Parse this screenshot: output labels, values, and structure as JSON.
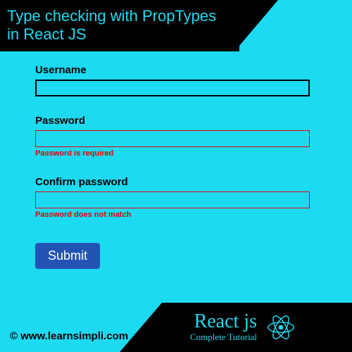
{
  "header": {
    "title": "Type checking with PropTypes\n in React JS"
  },
  "form": {
    "username": {
      "label": "Username",
      "value": "",
      "hasError": false
    },
    "password": {
      "label": "Password",
      "value": "",
      "hasError": true,
      "errorMsg": "Password is required"
    },
    "confirmPassword": {
      "label": "Confirm password",
      "value": "",
      "hasError": true,
      "errorMsg": "Password does not match"
    },
    "submitLabel": "Submit"
  },
  "footer": {
    "copyright": "©   www.learnsimpli.com",
    "brandTitle": "React js",
    "brandSubtitle": "Complete Tutorial"
  }
}
